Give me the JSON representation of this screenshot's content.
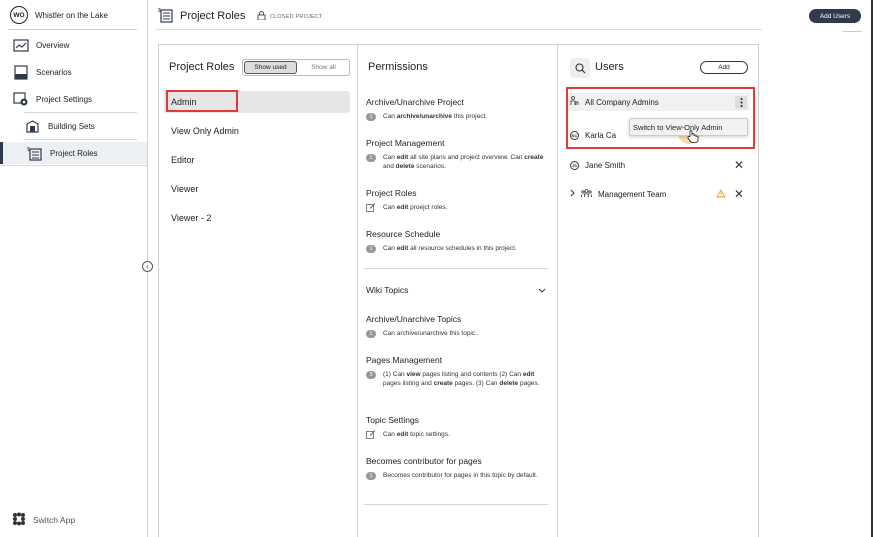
{
  "project": {
    "initials": "WO",
    "name": "Whistler on the Lake"
  },
  "sidebar": {
    "items": [
      {
        "label": "Overview",
        "icon": "overview-icon"
      },
      {
        "label": "Scenarios",
        "icon": "scenarios-icon"
      },
      {
        "label": "Project Settings",
        "icon": "project-settings-icon"
      },
      {
        "label": "Building Sets",
        "icon": "building-sets-icon"
      },
      {
        "label": "Project Roles",
        "icon": "project-roles-icon"
      }
    ],
    "switch_app": "Switch App"
  },
  "header": {
    "title": "Project Roles",
    "status": "CLOSED PROJECT",
    "add_users": "Add Users"
  },
  "roles_panel": {
    "title": "Project Roles",
    "toggle": {
      "show_used": "Show used",
      "show_all": "Show all"
    },
    "roles": [
      "Admin",
      "View Only Admin",
      "Editor",
      "Viewer",
      "Viewer - 2"
    ]
  },
  "permissions_panel": {
    "title": "Permissions",
    "items": [
      {
        "heading": "Archive/Unarchive Project",
        "badge": "1",
        "desc_parts": [
          "Can ",
          "archive/unarchive",
          " this project."
        ]
      },
      {
        "heading": "Project Management",
        "badge": "1",
        "desc_parts": [
          "Can ",
          "edit",
          " all site plans and project overview. Can ",
          "create",
          " and ",
          "delete",
          " scenarios."
        ]
      },
      {
        "heading": "Project Roles",
        "badge": "",
        "desc_parts": [
          "Can ",
          "edit",
          " proejct roles."
        ]
      },
      {
        "heading": "Resource Schedule",
        "badge": "1",
        "desc_parts": [
          "Can ",
          "edit",
          " all resource schedules in this project."
        ]
      }
    ],
    "wiki": {
      "title": "Wiki Topics",
      "items": [
        {
          "heading": "Archive/Unarchive Topics",
          "badge": "1",
          "desc_parts": [
            "Can archive/unarchive this topic.."
          ]
        },
        {
          "heading": "Pages Management",
          "badge": "3",
          "desc_parts": [
            "(1) Can ",
            "view",
            " pages listing and contents (2) Can ",
            "edit",
            " pages listing and ",
            "create",
            " pages. (3) Can ",
            "delete",
            " pages."
          ]
        },
        {
          "heading": "Topic Settings",
          "badge": "",
          "desc_parts": [
            "Can ",
            "edit",
            " topic settings."
          ]
        },
        {
          "heading": "Becomes contributor for pages",
          "badge": "1",
          "desc_parts": [
            "Becomes contributor for pages in this topic by default."
          ]
        }
      ]
    }
  },
  "users_panel": {
    "title": "Users",
    "add_label": "Add",
    "users": [
      {
        "name": "All Company Admins",
        "badge": ""
      },
      {
        "name": "Karla Ca",
        "badge": "KC"
      },
      {
        "name": "Jane Smith",
        "badge": "JS"
      },
      {
        "name": "Management Team",
        "badge": ""
      }
    ],
    "menu_item": "Switch to View-Only Admin"
  },
  "colors": {
    "accent": "#2f3b4b",
    "highlight": "#e03a3a",
    "warning": "#e8953a"
  }
}
